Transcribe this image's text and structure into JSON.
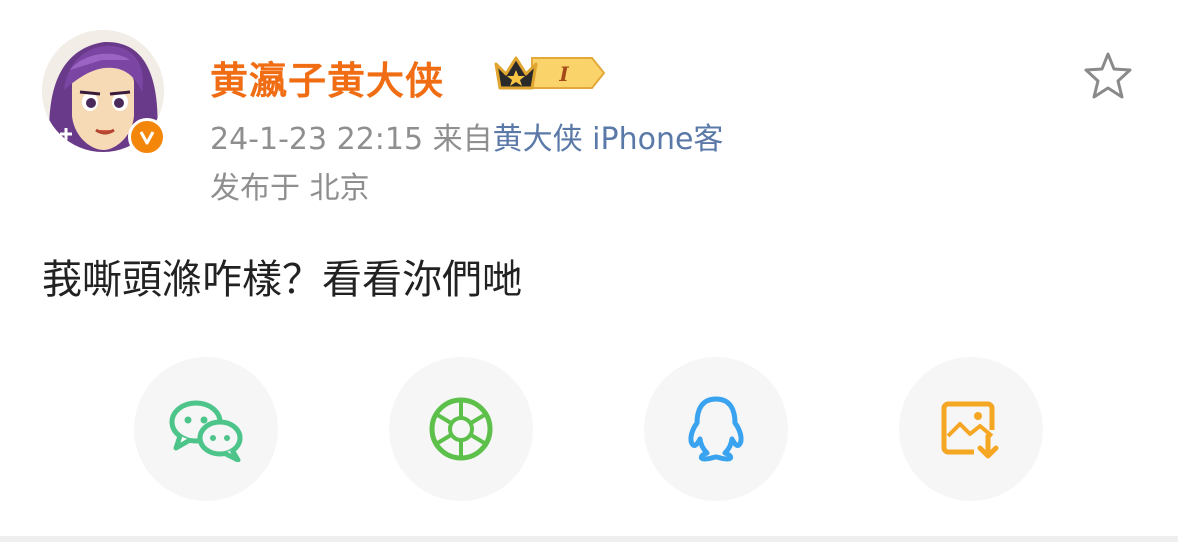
{
  "post": {
    "username": "黄瀛子黄大侠",
    "vip_level": "I",
    "date": "24-1-23 22:15",
    "from_prefix": "来自",
    "source": "黄大侠 iPhone客",
    "location": "发布于 北京",
    "text": "莪嘶頭滌咋樣？看看沵們哋"
  },
  "share": {
    "items": [
      "wechat-icon",
      "moments-icon",
      "qq-icon",
      "save-image-icon"
    ]
  },
  "colors": {
    "username": "#f06d14",
    "verified": "#f4870a",
    "source_link": "#5a79a8",
    "meta": "#8f8f8f",
    "wechat": "#4cc48a",
    "moments": "#5cc04a",
    "qq": "#3aa3f0",
    "save": "#f5a623"
  }
}
